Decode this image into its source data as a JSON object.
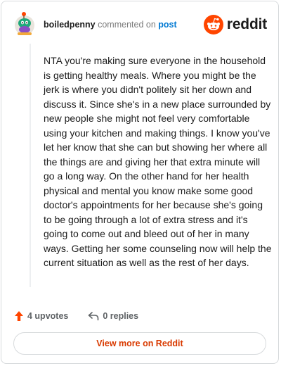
{
  "header": {
    "username": "boiledpenny",
    "action_text": "commented on",
    "post_link": "post",
    "brand": "reddit"
  },
  "comment": {
    "body": "NTA you're making sure everyone in the household is getting healthy meals. Where you might be the jerk is where you didn't politely sit her down and discuss it. Since she's in a new place surrounded by new people she might not feel very comfortable using your kitchen and making things. I know you've let her know that she can but showing her where all the things are and giving her that extra minute will go a long way. On the other hand for her health physical and mental you know make some good doctor's appointments for her because she's going to be going through a lot of extra stress and it's going to come out and bleed out of her in many ways. Getting her some counseling now will help the current situation as well as the rest of her days."
  },
  "footer": {
    "upvotes": "4 upvotes",
    "replies": "0 replies",
    "view_more": "View more on Reddit"
  },
  "colors": {
    "brand_orange": "#ff4500",
    "link_blue": "#0079d3",
    "view_more_text": "#d93a00"
  }
}
